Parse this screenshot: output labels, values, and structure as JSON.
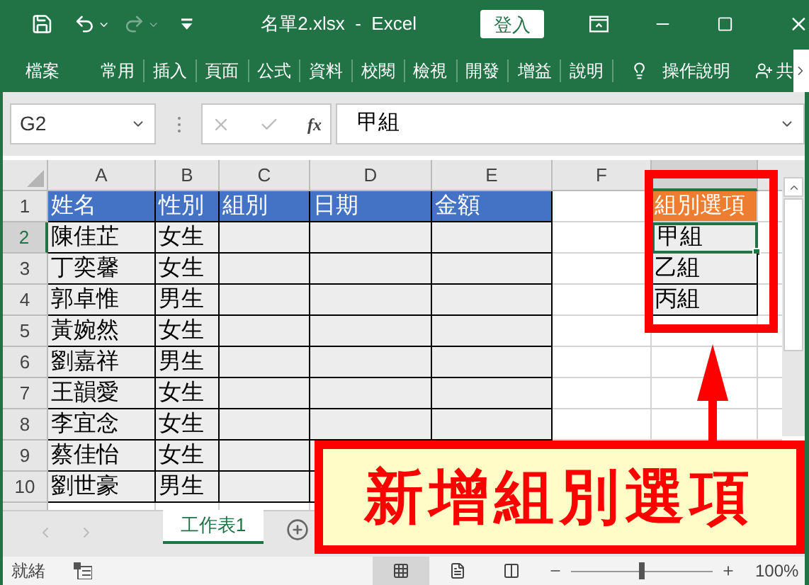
{
  "window": {
    "title": "名單2.xlsx  -  Excel",
    "sign_in": "登入"
  },
  "ribbon_tabs": [
    {
      "label": "檔案"
    },
    {
      "label": "常用"
    },
    {
      "label": "插入"
    },
    {
      "label": "頁面"
    },
    {
      "label": "公式"
    },
    {
      "label": "資料"
    },
    {
      "label": "校閱"
    },
    {
      "label": "檢視"
    },
    {
      "label": "開發"
    },
    {
      "label": "增益"
    },
    {
      "label": "說明"
    }
  ],
  "tell_me": "操作說明",
  "share": "共",
  "formula_bar": {
    "name_box": "G2",
    "function_label": "fx",
    "value": "甲組"
  },
  "columns": [
    {
      "label": "A",
      "selected": false
    },
    {
      "label": "B",
      "selected": false
    },
    {
      "label": "C",
      "selected": false
    },
    {
      "label": "D",
      "selected": false
    },
    {
      "label": "E",
      "selected": false
    },
    {
      "label": "F",
      "selected": false
    },
    {
      "selected": true
    }
  ],
  "row_numbers": [
    {
      "label": "1",
      "selected": false
    },
    {
      "label": "2",
      "selected": true
    },
    {
      "label": "3",
      "selected": false
    },
    {
      "label": "4",
      "selected": false
    },
    {
      "label": "5",
      "selected": false
    },
    {
      "label": "6",
      "selected": false
    },
    {
      "label": "7",
      "selected": false
    },
    {
      "label": "8",
      "selected": false
    },
    {
      "label": "9",
      "selected": false
    },
    {
      "label": "10",
      "selected": false
    }
  ],
  "table": {
    "headers": [
      "姓名",
      "性別",
      "組別",
      "日期",
      "金額"
    ],
    "rows": [
      [
        "陳佳芷",
        "女生"
      ],
      [
        "丁奕馨",
        "女生"
      ],
      [
        "郭卓惟",
        "男生"
      ],
      [
        "黃婉然",
        "女生"
      ],
      [
        "劉嘉祥",
        "男生"
      ],
      [
        "王韻愛",
        "女生"
      ],
      [
        "李宜念",
        "女生"
      ],
      [
        "蔡佳怡",
        "女生"
      ],
      [
        "劉世豪",
        "男生"
      ]
    ]
  },
  "group_options": {
    "header": "組別選項",
    "items": [
      {
        "text": "甲組",
        "selected": true
      },
      {
        "text": "乙組",
        "selected": false
      },
      {
        "text": "丙組",
        "selected": false
      }
    ]
  },
  "sheets": [
    {
      "label": "工作表1",
      "selected": true
    }
  ],
  "status_bar": {
    "status": "就緒",
    "zoom": "100%",
    "zoom_slider": {
      "level": 0.5
    }
  },
  "callout": {
    "text": "新增組別選項"
  }
}
